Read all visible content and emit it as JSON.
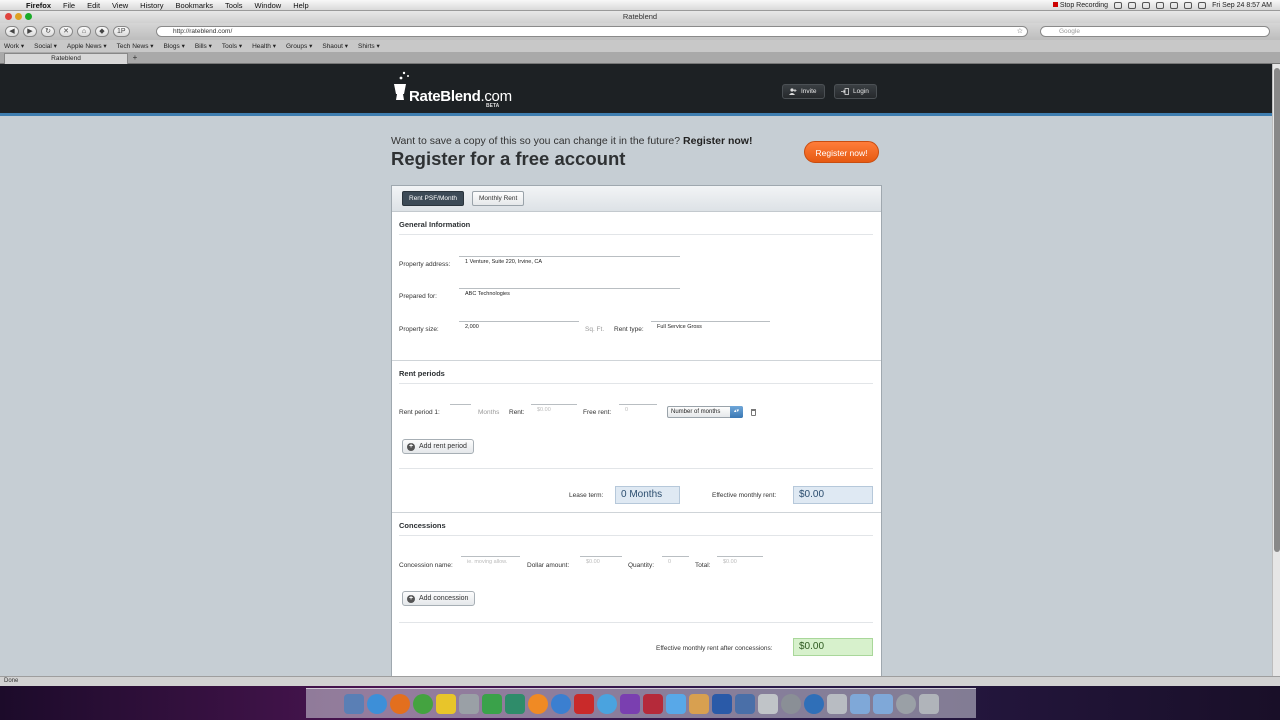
{
  "menubar": {
    "app": "Firefox",
    "items": [
      "File",
      "Edit",
      "View",
      "History",
      "Bookmarks",
      "Tools",
      "Window",
      "Help"
    ],
    "recording": "Stop Recording",
    "clock": "Fri Sep 24  8:57 AM"
  },
  "window": {
    "title": "Rateblend"
  },
  "toolbar": {
    "url": "http://rateblend.com/",
    "search_placeholder": "Google",
    "onepass": "1P"
  },
  "bookmarks": [
    "Work ▾",
    "Social ▾",
    "Apple News ▾",
    "Tech News ▾",
    "Blogs ▾",
    "Bills ▾",
    "Tools ▾",
    "Health ▾",
    "Groups ▾",
    "Shaout ▾",
    "Shirts ▾"
  ],
  "tabs": [
    {
      "label": "Rateblend"
    }
  ],
  "new_tab": "+",
  "header": {
    "logo_text": "RateBlend",
    "logo_suffix": ".com",
    "logo_beta": "BETA",
    "invite_label": "Invite",
    "login_label": "Login"
  },
  "promo": {
    "question": "Want to save a copy of this so you can change it in the future?",
    "question_cta": "Register now!",
    "title": "Register for a free account",
    "button": "Register now!"
  },
  "calc": {
    "tabs": [
      "Rent PSF/Month",
      "Monthly Rent"
    ],
    "general": {
      "title": "General Information",
      "address_label": "Property address:",
      "address_value": "1 Venture, Suite 220, Irvine, CA",
      "prepared_label": "Prepared for:",
      "prepared_value": "ABC Technologies",
      "size_label": "Property size:",
      "size_value": "2,000",
      "size_unit": "Sq. Ft.",
      "rent_type_label": "Rent type:",
      "rent_type_value": "Full Service Gross"
    },
    "rent_periods": {
      "title": "Rent periods",
      "period_label": "Rent period 1:",
      "months_unit": "Months",
      "rent_label": "Rent:",
      "rent_placeholder": "$0.00",
      "free_rent_label": "Free rent:",
      "free_rent_placeholder": "0",
      "free_rent_select": "Number of months",
      "add_button": "Add rent period",
      "lease_term_label": "Lease term:",
      "lease_term_value": "0 Months",
      "effective_label": "Effective monthly rent:",
      "effective_value": "$0.00"
    },
    "concessions": {
      "title": "Concessions",
      "name_label": "Concession name:",
      "name_placeholder": "ie. moving allow.",
      "amount_label": "Dollar amount:",
      "amount_placeholder": "$0.00",
      "quantity_label": "Quantity:",
      "quantity_placeholder": "0",
      "total_label": "Total:",
      "total_placeholder": "$0.00",
      "add_button": "Add concession",
      "after_label": "Effective monthly rent after concessions:",
      "after_value": "$0.00"
    }
  },
  "status": {
    "text": "Done"
  },
  "colors": {
    "accent": "#3f7eb0",
    "register_orange": "#f26b21",
    "header_bg": "#1d2124",
    "value_blue": "#dfe9f3",
    "value_green": "#d7f1cc"
  },
  "icons": [
    "apple-icon",
    "back-icon",
    "forward-icon",
    "reload-icon",
    "stop-icon",
    "home-icon",
    "star-icon",
    "invite-user-icon",
    "login-icon",
    "trash-icon",
    "add-icon",
    "logo-cup-icon"
  ]
}
